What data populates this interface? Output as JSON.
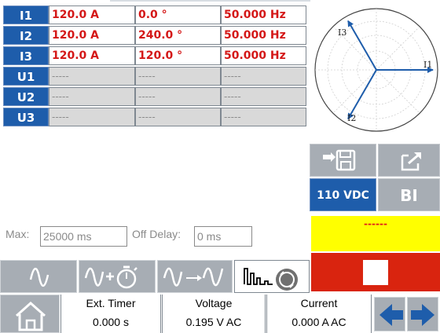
{
  "channels": [
    {
      "label": "I1",
      "magnitude": "120.0 A",
      "phase": "0.0 °",
      "frequency": "50.000 Hz",
      "active": true
    },
    {
      "label": "I2",
      "magnitude": "120.0 A",
      "phase": "240.0 °",
      "frequency": "50.000 Hz",
      "active": true
    },
    {
      "label": "I3",
      "magnitude": "120.0 A",
      "phase": "120.0 °",
      "frequency": "50.000 Hz",
      "active": true
    },
    {
      "label": "U1",
      "magnitude": "-----",
      "phase": "-----",
      "frequency": "-----",
      "active": false
    },
    {
      "label": "U2",
      "magnitude": "-----",
      "phase": "-----",
      "frequency": "-----",
      "active": false
    },
    {
      "label": "U3",
      "magnitude": "-----",
      "phase": "-----",
      "frequency": "-----",
      "active": false
    }
  ],
  "vector_diagram": {
    "labels": {
      "i1": "I1",
      "i2": "I2",
      "i3": "I3"
    },
    "vector_angles_deg": {
      "i1": 0,
      "i2": 240,
      "i3": 120
    },
    "color": "#1e5dab"
  },
  "buttons": {
    "vdc_label": "110 VDC",
    "bi_label": "BI",
    "save_icon": "save-to-disk-icon",
    "export_icon": "export-icon",
    "stop_icon": "stop-icon"
  },
  "status_indicator": {
    "text": "------",
    "color": "#ffff00"
  },
  "timing": {
    "max_label": "Max:",
    "max_value": "25000 ms",
    "off_delay_label": "Off Delay:",
    "off_delay_value": "0 ms"
  },
  "mode_tabs": [
    {
      "icon": "sine-wave-icon"
    },
    {
      "icon": "sine-timer-icon"
    },
    {
      "icon": "sine-ramp-icon"
    },
    {
      "icon": "sequence-icon",
      "selected": true
    }
  ],
  "statusbar": {
    "home_icon": "home-icon",
    "timer_title": "Ext. Timer",
    "timer_value": "0.000 s",
    "voltage_title": "Voltage",
    "voltage_value": "0.195 V AC",
    "current_title": "Current",
    "current_value": "0.000 A AC"
  },
  "colors": {
    "accent": "#1e5dab",
    "value_red": "#d41717",
    "stop_red": "#d9240f",
    "button_gray": "#a7adb4"
  }
}
